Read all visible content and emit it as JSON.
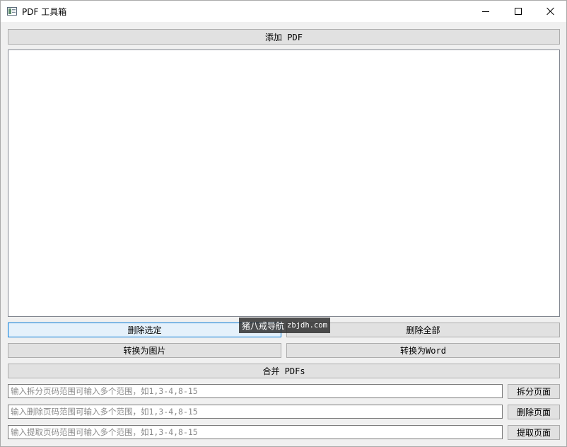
{
  "window": {
    "title": "PDF 工具箱",
    "app_icon": "pdf-app-icon",
    "controls": {
      "minimize": "minimize-icon",
      "maximize": "maximize-icon",
      "close": "close-icon"
    }
  },
  "toolbar": {
    "add_pdf_label": "添加 PDF"
  },
  "file_list": {
    "items": []
  },
  "actions": {
    "delete_selected_label": "删除选定",
    "delete_all_label": "删除全部",
    "to_image_label": "转换为图片",
    "to_word_label": "转换为Word",
    "merge_label": "合并 PDFs"
  },
  "split": {
    "placeholder": "输入拆分页码范围可输入多个范围，如1,3-4,8-15",
    "value": "",
    "button_label": "拆分页面"
  },
  "remove_pages": {
    "placeholder": "输入删除页码范围可输入多个范围，如1,3-4,8-15",
    "value": "",
    "button_label": "删除页面"
  },
  "extract": {
    "placeholder": "输入提取页码范围可输入多个范围，如1,3-4,8-15",
    "value": "",
    "button_label": "提取页面"
  },
  "watermark": {
    "site_name": "猪八戒导航",
    "site_url": "zbjdh.com"
  }
}
